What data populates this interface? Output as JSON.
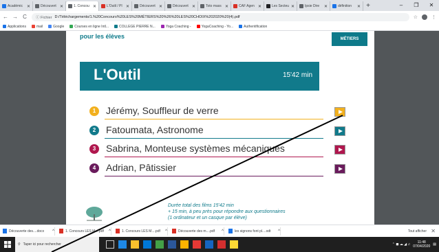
{
  "browser": {
    "tabs": [
      {
        "label": "Académic",
        "color": "#1a73e8"
      },
      {
        "label": "Découvert",
        "color": "#5f6368"
      },
      {
        "label": "1. Concou",
        "color": "#5f6368",
        "active": true
      },
      {
        "label": "L'Outil / Pl",
        "color": "#d93025"
      },
      {
        "label": "Découvert",
        "color": "#5f6368"
      },
      {
        "label": "Découvert",
        "color": "#5f6368"
      },
      {
        "label": "Toto mass",
        "color": "#5f6368"
      },
      {
        "label": "CAF Agen",
        "color": "#d93025"
      },
      {
        "label": "Les Secteu",
        "color": "#202124"
      },
      {
        "label": "Ipsie Dire",
        "color": "#5f6368"
      },
      {
        "label": "définition",
        "color": "#1a73e8"
      }
    ],
    "new_tab": "+",
    "window_controls": [
      "–",
      "❐",
      "✕"
    ],
    "nav": {
      "back": "←",
      "forward": "→",
      "reload": "C"
    },
    "omnibox": {
      "security": "ⓘ Fichier",
      "url": "D:/Téléchargements/1.%20Concours%20LES%20MÉTIERS%20%26%20LES%20CHOIX%202020%20(4).pdf"
    },
    "right_icons": [
      "☆",
      "⋮"
    ],
    "bookmarks": [
      {
        "label": "Applications",
        "color": "#1a73e8"
      },
      {
        "label": "mail",
        "color": "#ea4335"
      },
      {
        "label": "Google",
        "color": "#4285f4"
      },
      {
        "label": "Courses en ligne Intl...",
        "color": "#34a853"
      },
      {
        "label": "COLLEGE PIERRE N...",
        "color": "#0e7a8a"
      },
      {
        "label": "Yoga Coaching -",
        "color": "#9c27b0"
      },
      {
        "label": "YogaCoaching - Yo...",
        "color": "#ff0000"
      },
      {
        "label": "Authentification",
        "color": "#1a73e8"
      }
    ]
  },
  "pdf": {
    "top_text": "pour les élèves",
    "metiers_label": "MÉTIERS",
    "title": "L'Outil",
    "duration": "15'42 min",
    "items": [
      {
        "num": "1",
        "label": "Jérémy, Souffleur de verre",
        "color": "#f2b01e",
        "play_color": "#f2b01e"
      },
      {
        "num": "2",
        "label": "Fatoumata, Astronome",
        "color": "#117a8b",
        "play_color": "#117a8b"
      },
      {
        "num": "3",
        "label": "Sabrina, Monteuse systèmes mécaniques",
        "color": "#b0174e",
        "play_color": "#b0174e"
      },
      {
        "num": "4",
        "label": "Adrian, Pâtissier",
        "color": "#6a1b5c",
        "play_color": "#6a1b5c"
      }
    ],
    "note_lines": [
      "Durée total des films 15'42 min",
      "+ 15 min, à peu près pour répondre aux questionnaires",
      "(1 ordinateur et un casque par élève)"
    ]
  },
  "downloads": {
    "items": [
      {
        "label": "Découverte des....docx",
        "color": "#1a73e8"
      },
      {
        "label": "1. Concours LES M....pdf",
        "color": "#d93025"
      },
      {
        "label": "1. Concours LES M....pdf",
        "color": "#d93025"
      },
      {
        "label": "Découverte des m....pdf",
        "color": "#d93025"
      },
      {
        "label": "les signons font pl....odt",
        "color": "#1a73e8"
      }
    ],
    "show_all": "Tout afficher",
    "close": "✕"
  },
  "taskbar": {
    "search_placeholder": "Taper ici pour rechercher",
    "time": "11:48",
    "date": "07/04/2020"
  }
}
